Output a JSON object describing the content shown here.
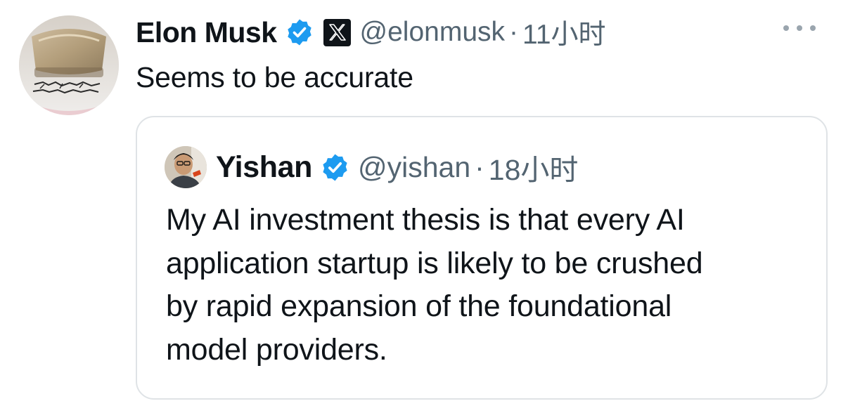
{
  "tweet": {
    "author": {
      "display_name": "Elon Musk",
      "handle": "@elonmusk",
      "verified": true,
      "affiliate_badge": "x-logo-icon"
    },
    "separator": "·",
    "time": "11小时",
    "text": "Seems to be accurate",
    "more_icon": "more-horizontal-icon",
    "quoted": {
      "author": {
        "display_name": "Yishan",
        "handle": "@yishan",
        "verified": true
      },
      "separator": "·",
      "time": "18小时",
      "text_lines": [
        "My AI investment thesis is that every AI",
        "application startup is likely to be crushed",
        "by rapid expansion of the foundational",
        "model providers."
      ]
    }
  },
  "colors": {
    "text_primary": "#0f1419",
    "text_secondary": "#536471",
    "verified_blue": "#1d9bf0",
    "card_border": "#dfe3e6"
  }
}
